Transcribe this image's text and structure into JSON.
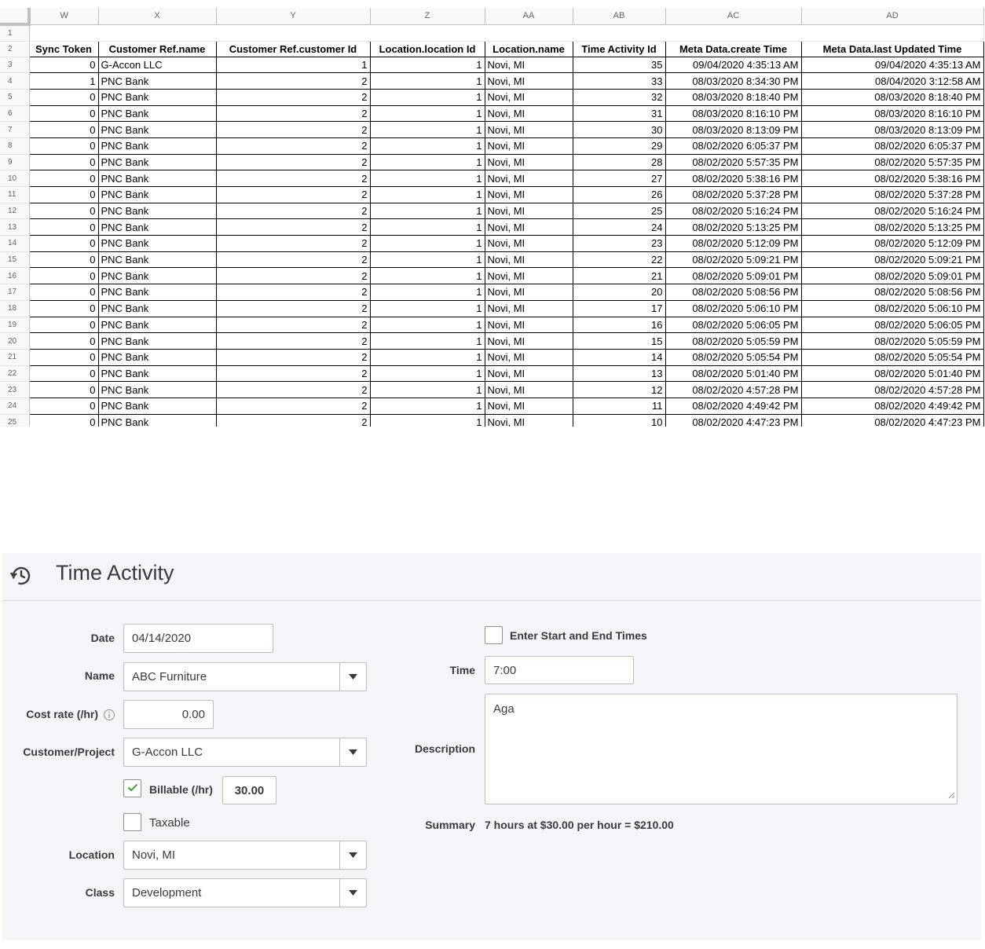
{
  "sheet": {
    "column_letters": [
      "W",
      "X",
      "Y",
      "Z",
      "AA",
      "AB",
      "AC",
      "AD"
    ],
    "headers": [
      "Sync Token",
      "Customer Ref.name",
      "Customer Ref.customer Id",
      "Location.location Id",
      "Location.name",
      "Time Activity Id",
      "Meta Data.create Time",
      "Meta Data.last Updated Time"
    ],
    "rows": [
      {
        "n": "3",
        "cells": [
          "0",
          "G-Accon LLC",
          "1",
          "1",
          "Novi, MI",
          "35",
          "09/04/2020 4:35:13 AM",
          "09/04/2020 4:35:13 AM"
        ]
      },
      {
        "n": "4",
        "cells": [
          "1",
          "PNC Bank",
          "2",
          "1",
          "Novi, MI",
          "33",
          "08/03/2020 8:34:30 PM",
          "08/04/2020 3:12:58 AM"
        ]
      },
      {
        "n": "5",
        "cells": [
          "0",
          "PNC Bank",
          "2",
          "1",
          "Novi, MI",
          "32",
          "08/03/2020 8:18:40 PM",
          "08/03/2020 8:18:40 PM"
        ]
      },
      {
        "n": "6",
        "cells": [
          "0",
          "PNC Bank",
          "2",
          "1",
          "Novi, MI",
          "31",
          "08/03/2020 8:16:10 PM",
          "08/03/2020 8:16:10 PM"
        ]
      },
      {
        "n": "7",
        "cells": [
          "0",
          "PNC Bank",
          "2",
          "1",
          "Novi, MI",
          "30",
          "08/03/2020 8:13:09 PM",
          "08/03/2020 8:13:09 PM"
        ]
      },
      {
        "n": "8",
        "cells": [
          "0",
          "PNC Bank",
          "2",
          "1",
          "Novi, MI",
          "29",
          "08/02/2020 6:05:37 PM",
          "08/02/2020 6:05:37 PM"
        ]
      },
      {
        "n": "9",
        "cells": [
          "0",
          "PNC Bank",
          "2",
          "1",
          "Novi, MI",
          "28",
          "08/02/2020 5:57:35 PM",
          "08/02/2020 5:57:35 PM"
        ]
      },
      {
        "n": "10",
        "cells": [
          "0",
          "PNC Bank",
          "2",
          "1",
          "Novi, MI",
          "27",
          "08/02/2020 5:38:16 PM",
          "08/02/2020 5:38:16 PM"
        ]
      },
      {
        "n": "11",
        "cells": [
          "0",
          "PNC Bank",
          "2",
          "1",
          "Novi, MI",
          "26",
          "08/02/2020 5:37:28 PM",
          "08/02/2020 5:37:28 PM"
        ]
      },
      {
        "n": "12",
        "cells": [
          "0",
          "PNC Bank",
          "2",
          "1",
          "Novi, MI",
          "25",
          "08/02/2020 5:16:24 PM",
          "08/02/2020 5:16:24 PM"
        ]
      },
      {
        "n": "13",
        "cells": [
          "0",
          "PNC Bank",
          "2",
          "1",
          "Novi, MI",
          "24",
          "08/02/2020 5:13:25 PM",
          "08/02/2020 5:13:25 PM"
        ]
      },
      {
        "n": "14",
        "cells": [
          "0",
          "PNC Bank",
          "2",
          "1",
          "Novi, MI",
          "23",
          "08/02/2020 5:12:09 PM",
          "08/02/2020 5:12:09 PM"
        ]
      },
      {
        "n": "15",
        "cells": [
          "0",
          "PNC Bank",
          "2",
          "1",
          "Novi, MI",
          "22",
          "08/02/2020 5:09:21 PM",
          "08/02/2020 5:09:21 PM"
        ]
      },
      {
        "n": "16",
        "cells": [
          "0",
          "PNC Bank",
          "2",
          "1",
          "Novi, MI",
          "21",
          "08/02/2020 5:09:01 PM",
          "08/02/2020 5:09:01 PM"
        ]
      },
      {
        "n": "17",
        "cells": [
          "0",
          "PNC Bank",
          "2",
          "1",
          "Novi, MI",
          "20",
          "08/02/2020 5:08:56 PM",
          "08/02/2020 5:08:56 PM"
        ]
      },
      {
        "n": "18",
        "cells": [
          "0",
          "PNC Bank",
          "2",
          "1",
          "Novi, MI",
          "17",
          "08/02/2020 5:06:10 PM",
          "08/02/2020 5:06:10 PM"
        ]
      },
      {
        "n": "19",
        "cells": [
          "0",
          "PNC Bank",
          "2",
          "1",
          "Novi, MI",
          "16",
          "08/02/2020 5:06:05 PM",
          "08/02/2020 5:06:05 PM"
        ]
      },
      {
        "n": "20",
        "cells": [
          "0",
          "PNC Bank",
          "2",
          "1",
          "Novi, MI",
          "15",
          "08/02/2020 5:05:59 PM",
          "08/02/2020 5:05:59 PM"
        ]
      },
      {
        "n": "21",
        "cells": [
          "0",
          "PNC Bank",
          "2",
          "1",
          "Novi, MI",
          "14",
          "08/02/2020 5:05:54 PM",
          "08/02/2020 5:05:54 PM"
        ]
      },
      {
        "n": "22",
        "cells": [
          "0",
          "PNC Bank",
          "2",
          "1",
          "Novi, MI",
          "13",
          "08/02/2020 5:01:40 PM",
          "08/02/2020 5:01:40 PM"
        ]
      },
      {
        "n": "23",
        "cells": [
          "0",
          "PNC Bank",
          "2",
          "1",
          "Novi, MI",
          "12",
          "08/02/2020 4:57:28 PM",
          "08/02/2020 4:57:28 PM"
        ]
      },
      {
        "n": "24",
        "cells": [
          "0",
          "PNC Bank",
          "2",
          "1",
          "Novi, MI",
          "11",
          "08/02/2020 4:49:42 PM",
          "08/02/2020 4:49:42 PM"
        ]
      },
      {
        "n": "25",
        "cells": [
          "0",
          "PNC Bank",
          "2",
          "1",
          "Novi, MI",
          "10",
          "08/02/2020 4:47:23 PM",
          "08/02/2020 4:47:23 PM"
        ]
      }
    ]
  },
  "form": {
    "title": "Time Activity",
    "title_icon": "history-clock-icon",
    "date_label": "Date",
    "date_value": "04/14/2020",
    "name_label": "Name",
    "name_value": "ABC Furniture",
    "cost_rate_label": "Cost rate (/hr)",
    "cost_rate_value": "0.00",
    "customer_label": "Customer/Project",
    "customer_value": "G-Accon LLC",
    "billable_label": "Billable (/hr)",
    "billable_checked": true,
    "billable_rate": "30.00",
    "taxable_label": "Taxable",
    "taxable_checked": false,
    "location_label": "Location",
    "location_value": "Novi, MI",
    "class_label": "Class",
    "class_value": "Development",
    "start_end_label": "Enter Start and End Times",
    "start_end_checked": false,
    "time_label": "Time",
    "time_value": "7:00",
    "description_label": "Description",
    "description_value": "Aga",
    "summary_label": "Summary",
    "summary_value": "7 hours at $30.00 per hour = $210.00"
  },
  "colors": {
    "form_background": "#f4f5f8",
    "text": "#393a3d",
    "checkmark": "#2ca01c",
    "input_border": "#babec5"
  }
}
